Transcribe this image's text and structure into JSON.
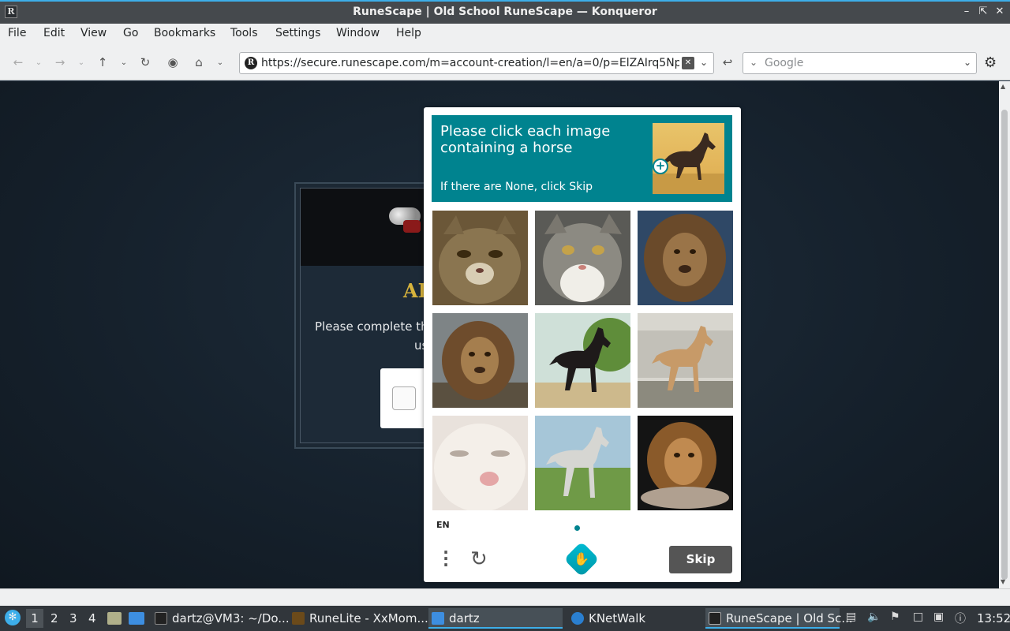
{
  "window": {
    "title": "RuneScape | Old School RuneScape — Konqueror",
    "app_icon": "R",
    "buttons": [
      "minimize-icon",
      "maximize-icon",
      "close-icon"
    ]
  },
  "menubar": [
    "File",
    "Edit",
    "View",
    "Go",
    "Bookmarks",
    "Tools",
    "Settings",
    "Window",
    "Help"
  ],
  "toolbar": {
    "url": "https://secure.runescape.com/m=account-creation/l=en/a=0/p=ElZAIrq5NpKF",
    "site_icon": "R",
    "search_placeholder": "Google"
  },
  "runescape_page": {
    "heading_partial": "AR",
    "text_line1": "Please complete th",
    "text_line2": "us"
  },
  "captcha": {
    "prompt_main": "Please click each image containing a horse",
    "prompt_sub": "If there are None, click Skip",
    "plus_icon": "+",
    "tiles": [
      "cat",
      "cat",
      "lion",
      "lion",
      "horse",
      "horse",
      "cat",
      "horse",
      "lion"
    ],
    "language": "EN",
    "skip_label": "Skip",
    "accent_color": "#00838f"
  },
  "taskbar": {
    "workspaces": [
      "1",
      "2",
      "3",
      "4"
    ],
    "tasks": [
      {
        "label": "dartz@VM3: ~/Do...",
        "icon": "terminal-icon"
      },
      {
        "label": "RuneLite - XxMom...",
        "icon": "runelite-icon"
      },
      {
        "label": "dartz",
        "icon": "folder-icon"
      },
      {
        "label": "KNetWalk",
        "icon": "knetwalk-icon"
      },
      {
        "label": "RuneScape | Old Sc...",
        "icon": "konqueror-icon"
      }
    ],
    "clock": "13:52"
  }
}
